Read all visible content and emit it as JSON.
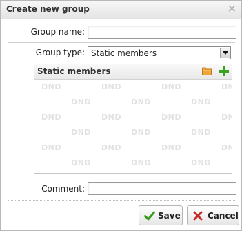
{
  "dialog": {
    "title": "Create new group",
    "close_icon": "close-icon"
  },
  "form": {
    "group_name_label": "Group name:",
    "group_name_value": "",
    "group_type_label": "Group type:",
    "group_type_selected": "Static members",
    "comment_label": "Comment:",
    "comment_value": ""
  },
  "members_panel": {
    "title": "Static members",
    "icons": [
      "folder-icon",
      "add-icon"
    ],
    "watermark": "DND"
  },
  "buttons": {
    "save_label": "Save",
    "cancel_label": "Cancel"
  },
  "colors": {
    "save_check": "#3a9a1c",
    "cancel_x": "#c62828",
    "add_plus": "#3aa31f",
    "folder": "#f0a53a"
  }
}
